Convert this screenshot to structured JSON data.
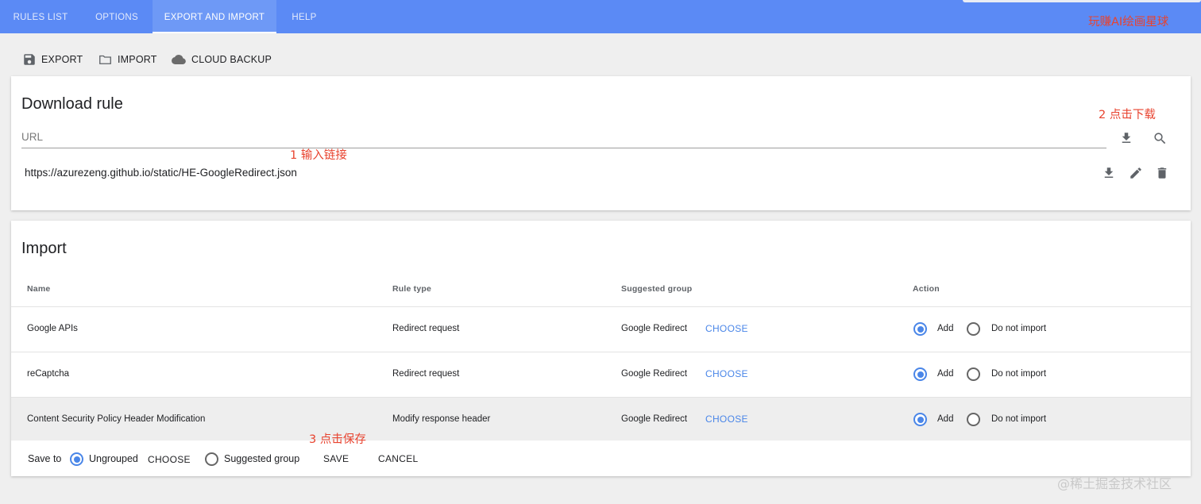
{
  "tabs": [
    {
      "label": "RULES LIST"
    },
    {
      "label": "OPTIONS"
    },
    {
      "label": "EXPORT AND IMPORT",
      "active": true
    },
    {
      "label": "HELP"
    }
  ],
  "toolbar": {
    "export_label": "EXPORT",
    "import_label": "IMPORT",
    "cloud_label": "CLOUD BACKUP"
  },
  "download": {
    "title": "Download rule",
    "url_placeholder": "URL",
    "url_value": "",
    "saved_url": "https://azurezeng.github.io/static/HE-GoogleRedirect.json",
    "icons": [
      "download-icon",
      "search-icon",
      "download-icon",
      "edit-icon",
      "delete-icon"
    ]
  },
  "import": {
    "title": "Import",
    "columns": [
      "Name",
      "Rule type",
      "Suggested group",
      "Action"
    ],
    "rows": [
      {
        "name": "Google APIs",
        "rule_type": "Redirect request",
        "group": "Google Redirect",
        "choose": "CHOOSE",
        "add": "Add",
        "skip": "Do not import",
        "selected": "Add"
      },
      {
        "name": "reCaptcha",
        "rule_type": "Redirect request",
        "group": "Google Redirect",
        "choose": "CHOOSE",
        "add": "Add",
        "skip": "Do not import",
        "selected": "Add"
      },
      {
        "name": "Content Security Policy Header Modification",
        "rule_type": "Modify response header",
        "group": "Google Redirect",
        "choose": "CHOOSE",
        "add": "Add",
        "skip": "Do not import",
        "selected": "Add"
      }
    ],
    "footer": {
      "save_to": "Save to",
      "ungrouped": "Ungrouped",
      "choose": "CHOOSE",
      "suggested": "Suggested group",
      "save": "SAVE",
      "cancel": "CANCEL",
      "selected": "Ungrouped"
    }
  },
  "annotations": {
    "top_right": "玩赚AI绘画星球",
    "step1": "1 输入链接",
    "step2": "2 点击下载",
    "step3": "3 点击保存"
  },
  "watermark": "@稀土掘金技术社区",
  "colors": {
    "header": "#5b8af5",
    "accent": "#4a86e8",
    "annotation": "#e8432f"
  }
}
